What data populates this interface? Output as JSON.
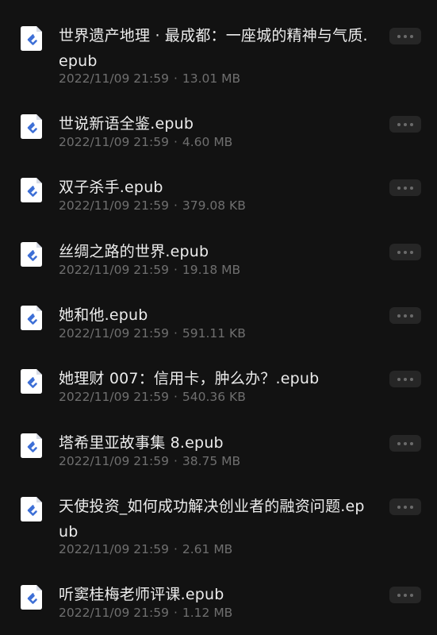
{
  "files": [
    {
      "name": "世界遗产地理 · 最成都：一座城的精神与气质.epub",
      "date": "2022/11/09 21:59",
      "size": "13.01 MB"
    },
    {
      "name": "世说新语全鉴.epub",
      "date": "2022/11/09 21:59",
      "size": "4.60 MB"
    },
    {
      "name": "双子杀手.epub",
      "date": "2022/11/09 21:59",
      "size": "379.08 KB"
    },
    {
      "name": "丝绸之路的世界.epub",
      "date": "2022/11/09 21:59",
      "size": "19.18 MB"
    },
    {
      "name": "她和他.epub",
      "date": "2022/11/09 21:59",
      "size": "591.11 KB"
    },
    {
      "name": "她理财 007：信用卡，肿么办？.epub",
      "date": "2022/11/09 21:59",
      "size": "540.36 KB"
    },
    {
      "name": "塔希里亚故事集 8.epub",
      "date": "2022/11/09 21:59",
      "size": "38.75 MB"
    },
    {
      "name": "天使投资_如何成功解决创业者的融资问题.epub",
      "date": "2022/11/09 21:59",
      "size": "2.61 MB"
    },
    {
      "name": "听窦桂梅老师评课.epub",
      "date": "2022/11/09 21:59",
      "size": "1.12 MB"
    }
  ],
  "meta_separator": "·",
  "icons": {
    "file": "epub-file-icon",
    "more": "more-options-icon"
  },
  "colors": {
    "background": "#121212",
    "icon_accent": "#3d6fd6",
    "meta_text": "#6f6f6f"
  }
}
